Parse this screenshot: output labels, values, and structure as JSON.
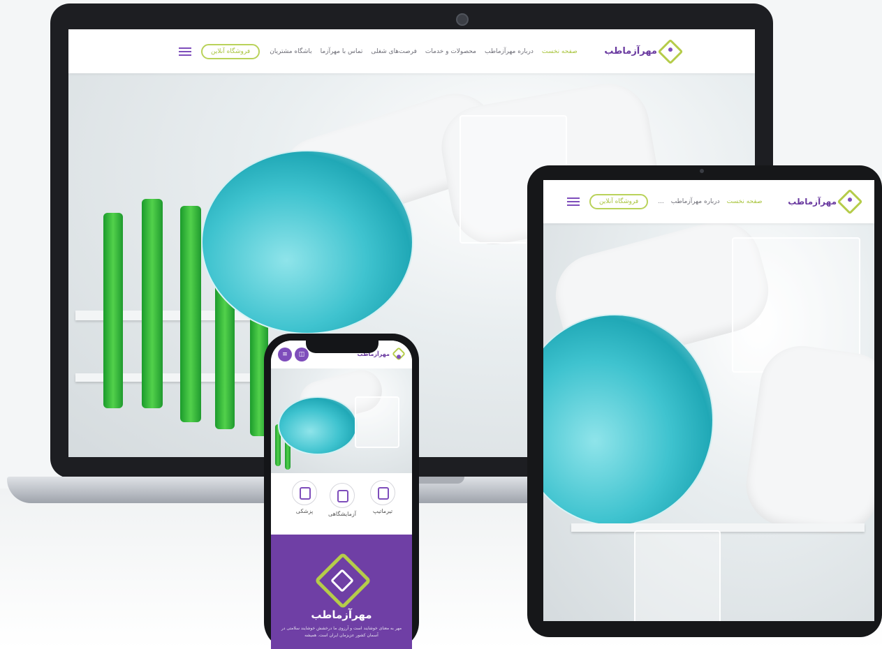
{
  "brand": {
    "name": "مهرآزماطب",
    "colors": {
      "purple": "#6f3fa5",
      "lime": "#a8c43d",
      "teal": "#3fc3cf"
    }
  },
  "desktop_nav": {
    "items": [
      "صفحه نخست",
      "درباره مهرآزماطب",
      "محصولات و خدمات",
      "فرصت‌های شغلی",
      "تماس با مهرآزما",
      "باشگاه مشتریان"
    ],
    "active_index": 0,
    "shop_button": "فروشگاه آنلاین",
    "menu_icon": "hamburger-icon"
  },
  "tablet_nav": {
    "items": [
      "صفحه نخست",
      "درباره مهرآزماطب",
      "..."
    ],
    "shop_button": "فروشگاه آنلاین",
    "menu_icon": "hamburger-icon"
  },
  "mobile": {
    "logo_text": "مهرآزماطب",
    "services": [
      "تیرماتیپ",
      "آزمایشگاهی",
      "پزشکی"
    ],
    "footer_brand": "مهرآزماطب",
    "tagline": "مهر به معنای خوشایند است و آرزوی ما درخشش خوشایند سلامتی در آسمان کشور عزیزمان ایران است. همیشه"
  }
}
